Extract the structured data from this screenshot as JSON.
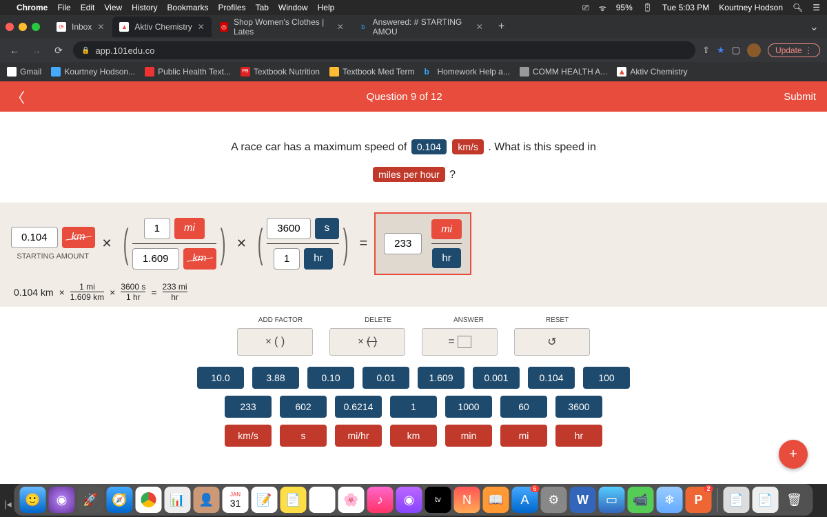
{
  "menubar": {
    "app": "Chrome",
    "items": [
      "File",
      "Edit",
      "View",
      "History",
      "Bookmarks",
      "Profiles",
      "Tab",
      "Window",
      "Help"
    ],
    "battery": "95%",
    "time": "Tue 5:03 PM",
    "user": "Kourtney Hodson"
  },
  "tabs": {
    "t0": "Inbox",
    "t1": "Aktiv Chemistry",
    "t2": "Shop Women's Clothes | Lates",
    "t3": "Answered: # STARTING AMOU"
  },
  "address": {
    "url": "app.101edu.co",
    "update": "Update"
  },
  "bookmarks": {
    "b0": "Gmail",
    "b1": "Kourtney Hodson...",
    "b2": "Public Health Text...",
    "b3": "Textbook Nutrition",
    "b4": "Textbook Med Term",
    "b5": "Homework Help a...",
    "b6": "COMM HEALTH A...",
    "b7": "Aktiv Chemistry"
  },
  "header": {
    "title": "Question 9 of 12",
    "submit": "Submit"
  },
  "question": {
    "pre": "A race car has a maximum speed of",
    "val": "0.104",
    "unit1": "km/s",
    "mid": ". What is this speed in",
    "unit2": "miles per hour",
    "post": "?"
  },
  "work": {
    "start_val": "0.104",
    "start_unit": "km",
    "start_label": "STARTING AMOUNT",
    "f1": {
      "tn": "1",
      "tu": "mi",
      "bn": "1.609",
      "bu": "km"
    },
    "f2": {
      "tn": "3600",
      "tu": "s",
      "bn": "1",
      "bu": "hr"
    },
    "ans": {
      "n": "233",
      "tu": "mi",
      "bu": "hr"
    },
    "readout": {
      "a": "0.104 km",
      "b_top": "1 mi",
      "b_bot": "1.609 km",
      "c_top": "3600 s",
      "c_bot": "1 hr",
      "d_top": "233 mi",
      "d_bot": "hr"
    }
  },
  "controls": {
    "h0": "ADD FACTOR",
    "h1": "DELETE",
    "h2": "ANSWER",
    "h3": "RESET",
    "af": "( )",
    "ans_eq": "=",
    "reset": "↺",
    "row1": [
      "10.0",
      "3.88",
      "0.10",
      "0.01",
      "1.609",
      "0.001",
      "0.104",
      "100"
    ],
    "row2": [
      "233",
      "602",
      "0.6214",
      "1",
      "1000",
      "60",
      "3600"
    ],
    "row3": [
      "km/s",
      "s",
      "mi/hr",
      "km",
      "min",
      "mi",
      "hr"
    ]
  },
  "dock": {
    "cal_month": "JAN",
    "cal_day": "31",
    "tv": "tv",
    "w": "W",
    "p": "P",
    "badge6": "6",
    "badge2": "2"
  }
}
